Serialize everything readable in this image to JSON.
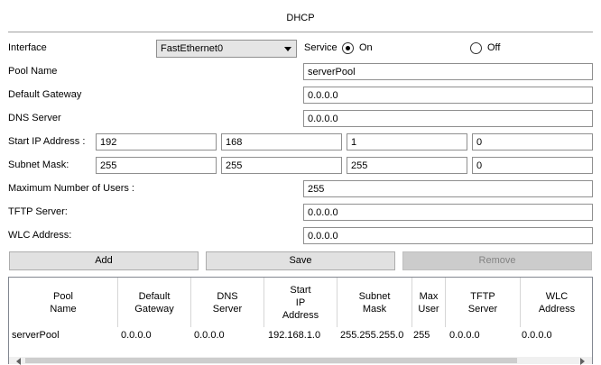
{
  "title": "DHCP",
  "interface": {
    "label": "Interface",
    "value": "FastEthernet0"
  },
  "service": {
    "label": "Service",
    "on_label": "On",
    "off_label": "Off",
    "selected": "On"
  },
  "pool_name": {
    "label": "Pool Name",
    "value": "serverPool"
  },
  "default_gateway": {
    "label": "Default Gateway",
    "value": "0.0.0.0"
  },
  "dns_server": {
    "label": "DNS Server",
    "value": "0.0.0.0"
  },
  "start_ip": {
    "label": "Start IP Address :",
    "octets": [
      "192",
      "168",
      "1",
      "0"
    ]
  },
  "subnet_mask": {
    "label": "Subnet Mask:",
    "octets": [
      "255",
      "255",
      "255",
      "0"
    ]
  },
  "max_users": {
    "label": "Maximum Number of Users :",
    "value": "255"
  },
  "tftp_server": {
    "label": "TFTP Server:",
    "value": "0.0.0.0"
  },
  "wlc_address": {
    "label": "WLC Address:",
    "value": "0.0.0.0"
  },
  "buttons": {
    "add": "Add",
    "save": "Save",
    "remove": "Remove"
  },
  "table": {
    "columns": [
      "Pool\nName",
      "Default\nGateway",
      "DNS\nServer",
      "Start\nIP\nAddress",
      "Subnet\nMask",
      "Max\nUser",
      "TFTP\nServer",
      "WLC\nAddress"
    ],
    "rows": [
      [
        "serverPool",
        "0.0.0.0",
        "0.0.0.0",
        "192.168.1.0",
        "255.255.255.0",
        "255",
        "0.0.0.0",
        "0.0.0.0"
      ]
    ]
  }
}
